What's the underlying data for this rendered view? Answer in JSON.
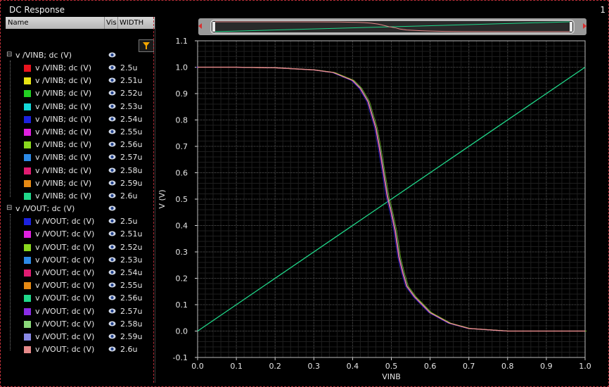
{
  "window": {
    "title": "DC Response",
    "number": "1"
  },
  "columns": {
    "name": "Name",
    "vis": "Vis",
    "width": "WIDTH"
  },
  "groups": [
    {
      "label": "v /VINB; dc (V)",
      "items": [
        {
          "label": "v /VINB; dc (V)",
          "width": "2.5u",
          "color": "#e8141e"
        },
        {
          "label": "v /VINB; dc (V)",
          "width": "2.51u",
          "color": "#e8e414"
        },
        {
          "label": "v /VINB; dc (V)",
          "width": "2.52u",
          "color": "#22d022"
        },
        {
          "label": "v /VINB; dc (V)",
          "width": "2.53u",
          "color": "#14d8d8"
        },
        {
          "label": "v /VINB; dc (V)",
          "width": "2.54u",
          "color": "#1c22e0"
        },
        {
          "label": "v /VINB; dc (V)",
          "width": "2.55u",
          "color": "#e020e0"
        },
        {
          "label": "v /VINB; dc (V)",
          "width": "2.56u",
          "color": "#8ad81e"
        },
        {
          "label": "v /VINB; dc (V)",
          "width": "2.57u",
          "color": "#2c8ae6"
        },
        {
          "label": "v /VINB; dc (V)",
          "width": "2.58u",
          "color": "#e01c72"
        },
        {
          "label": "v /VINB; dc (V)",
          "width": "2.59u",
          "color": "#e68a14"
        },
        {
          "label": "v /VINB; dc (V)",
          "width": "2.6u",
          "color": "#20d88a"
        }
      ]
    },
    {
      "label": "v /VOUT; dc (V)",
      "items": [
        {
          "label": "v /VOUT; dc (V)",
          "width": "2.5u",
          "color": "#1c22e0"
        },
        {
          "label": "v /VOUT; dc (V)",
          "width": "2.51u",
          "color": "#e020e0"
        },
        {
          "label": "v /VOUT; dc (V)",
          "width": "2.52u",
          "color": "#8ad81e"
        },
        {
          "label": "v /VOUT; dc (V)",
          "width": "2.53u",
          "color": "#2c8ae6"
        },
        {
          "label": "v /VOUT; dc (V)",
          "width": "2.54u",
          "color": "#e01c72"
        },
        {
          "label": "v /VOUT; dc (V)",
          "width": "2.55u",
          "color": "#e68a14"
        },
        {
          "label": "v /VOUT; dc (V)",
          "width": "2.56u",
          "color": "#20d88a"
        },
        {
          "label": "v /VOUT; dc (V)",
          "width": "2.57u",
          "color": "#8a2ce6"
        },
        {
          "label": "v /VOUT; dc (V)",
          "width": "2.58u",
          "color": "#8ad87a"
        },
        {
          "label": "v /VOUT; dc (V)",
          "width": "2.59u",
          "color": "#8a8ae6"
        },
        {
          "label": "v /VOUT; dc (V)",
          "width": "2.6u",
          "color": "#e68a8a"
        }
      ]
    }
  ],
  "chart_data": {
    "type": "line",
    "xlabel": "VINB",
    "ylabel": "V (V)",
    "xlim": [
      0,
      1
    ],
    "ylim": [
      -0.1,
      1.1
    ],
    "xticks": [
      "0.0",
      "0.1",
      "0.2",
      "0.3",
      "0.4",
      "0.5",
      "0.6",
      "0.7",
      "0.8",
      "0.9",
      "1.0"
    ],
    "yticks": [
      "-0.1",
      "0.0",
      "0.1",
      "0.2",
      "0.3",
      "0.4",
      "0.5",
      "0.6",
      "0.7",
      "0.8",
      "0.9",
      "1.0",
      "1.1"
    ],
    "grid": true,
    "series": [
      {
        "name": "v /VINB; dc (V)",
        "color": "#20d88a",
        "x": [
          0.0,
          1.0
        ],
        "y": [
          0.0,
          1.0
        ]
      },
      {
        "name": "v /VOUT; dc (V)",
        "color": "#e68a8a",
        "x": [
          0.0,
          0.1,
          0.2,
          0.3,
          0.35,
          0.4,
          0.42,
          0.44,
          0.46,
          0.47,
          0.48,
          0.49,
          0.5,
          0.51,
          0.52,
          0.53,
          0.54,
          0.56,
          0.58,
          0.6,
          0.65,
          0.7,
          0.8,
          0.9,
          1.0
        ],
        "y": [
          1.0,
          1.0,
          0.998,
          0.99,
          0.98,
          0.95,
          0.92,
          0.87,
          0.77,
          0.69,
          0.6,
          0.51,
          0.45,
          0.38,
          0.28,
          0.22,
          0.17,
          0.13,
          0.1,
          0.07,
          0.03,
          0.01,
          0.0,
          0.0,
          0.0
        ]
      }
    ]
  }
}
